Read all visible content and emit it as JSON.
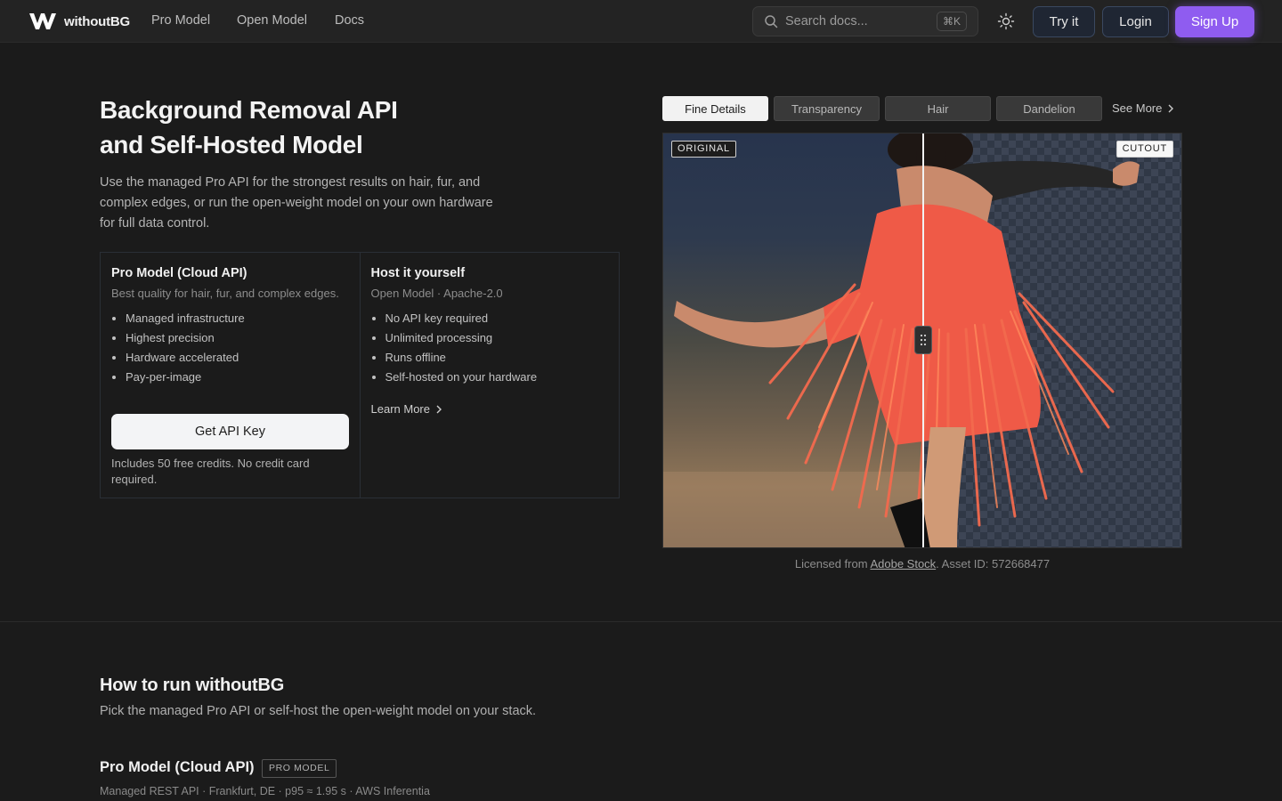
{
  "brand": {
    "name": "withoutBG"
  },
  "nav": {
    "links": [
      "Pro Model",
      "Open Model",
      "Docs"
    ],
    "search_placeholder": "Search docs...",
    "search_shortcut": "⌘K",
    "try_label": "Try it",
    "login_label": "Login",
    "signup_label": "Sign Up"
  },
  "hero": {
    "title_line1": "Background Removal API",
    "title_line2": "and Self-Hosted Model",
    "subtitle": "Use the managed Pro API for the strongest results on hair, fur, and complex edges, or run the open-weight model on your own hardware for full data control."
  },
  "cards": {
    "pro": {
      "title": "Pro Model (Cloud API)",
      "subtitle": "Best quality for hair, fur, and complex edges.",
      "features": [
        "Managed infrastructure",
        "Highest precision",
        "Hardware accelerated",
        "Pay-per-image"
      ],
      "cta": "Get API Key",
      "note": "Includes 50 free credits. No credit card required."
    },
    "self": {
      "title": "Host it yourself",
      "subtitle": "Open Model · Apache-2.0",
      "features": [
        "No API key required",
        "Unlimited processing",
        "Runs offline",
        "Self-hosted on your hardware"
      ],
      "link": "Learn More"
    }
  },
  "demo": {
    "tabs": [
      "Fine Details",
      "Transparency",
      "Hair",
      "Dandelion"
    ],
    "active_tab": "Fine Details",
    "see_more": "See More",
    "badge_original": "ORIGINAL",
    "badge_cutout": "CUTOUT",
    "credit_prefix": "Licensed from",
    "credit_link": "Adobe Stock",
    "credit_suffix": ". Asset ID: 572668477"
  },
  "how": {
    "title": "How to run withoutBG",
    "subtitle": "Pick the managed Pro API or self-host the open-weight model on your stack.",
    "pro_title": "Pro Model (Cloud API)",
    "pro_badge": "PRO MODEL",
    "pro_meta": "Managed REST API · Frankfurt, DE · p95 ≈ 1.95 s · AWS Inferentia"
  },
  "colors": {
    "accent": "#8f5cf0",
    "dress": "#f0513c",
    "background": "#1b1b1b"
  }
}
